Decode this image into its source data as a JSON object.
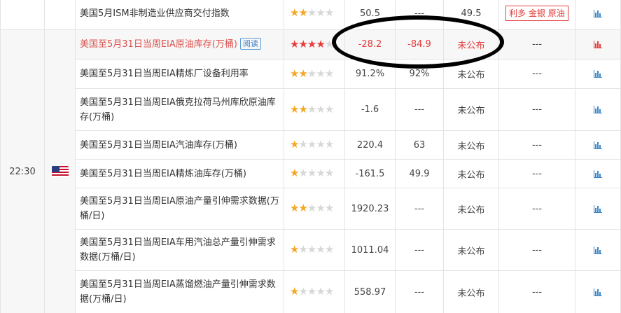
{
  "time_label": "22:30",
  "flag_country": "US",
  "colors": {
    "important_text": "#d9534f",
    "star_on": "#f5a623",
    "star_on_important": "#e83c3c",
    "star_off": "#d7d7d7",
    "actual_red": "#e23c3c",
    "chart_icon_blue": "#3d86c6",
    "chart_icon_red": "#e23c3c"
  },
  "icons": {
    "chart": "bar-chart-icon",
    "flag": "us-flag-icon"
  },
  "rows": [
    {
      "name": "美国5月ISM非制造业供应商交付指数",
      "stars": 2,
      "previous": "50.5",
      "forecast": "---",
      "actual": "49.5",
      "effect": "利多 金银 原油",
      "important": false
    },
    {
      "name": "美国至5月31日当周EIA原油库存(万桶)",
      "read_label": "阅读",
      "stars": 4,
      "previous": "-28.2",
      "forecast": "-84.9",
      "actual": "未公布",
      "effect": "---",
      "important": true
    },
    {
      "name": "美国至5月31日当周EIA精炼厂设备利用率",
      "stars": 2,
      "previous": "91.2%",
      "forecast": "92%",
      "actual": "未公布",
      "effect": "---",
      "important": false
    },
    {
      "name": "美国至5月31日当周EIA俄克拉荷马州库欣原油库存(万桶)",
      "stars": 2,
      "previous": "-1.6",
      "forecast": "---",
      "actual": "未公布",
      "effect": "---",
      "important": false
    },
    {
      "name": "美国至5月31日当周EIA汽油库存(万桶)",
      "stars": 1,
      "previous": "220.4",
      "forecast": "63",
      "actual": "未公布",
      "effect": "---",
      "important": false
    },
    {
      "name": "美国至5月31日当周EIA精炼油库存(万桶)",
      "stars": 1,
      "previous": "-161.5",
      "forecast": "49.9",
      "actual": "未公布",
      "effect": "---",
      "important": false
    },
    {
      "name": "美国至5月31日当周EIA原油产量引伸需求数据(万桶/日)",
      "stars": 2,
      "previous": "1920.23",
      "forecast": "---",
      "actual": "未公布",
      "effect": "---",
      "important": false
    },
    {
      "name": "美国至5月31日当周EIA车用汽油总产量引伸需求数据(万桶/日)",
      "stars": 1,
      "previous": "1011.04",
      "forecast": "---",
      "actual": "未公布",
      "effect": "---",
      "important": false
    },
    {
      "name": "美国至5月31日当周EIA蒸馏燃油产量引伸需求数据(万桶/日)",
      "stars": 1,
      "previous": "558.97",
      "forecast": "---",
      "actual": "未公布",
      "effect": "---",
      "important": false
    }
  ]
}
